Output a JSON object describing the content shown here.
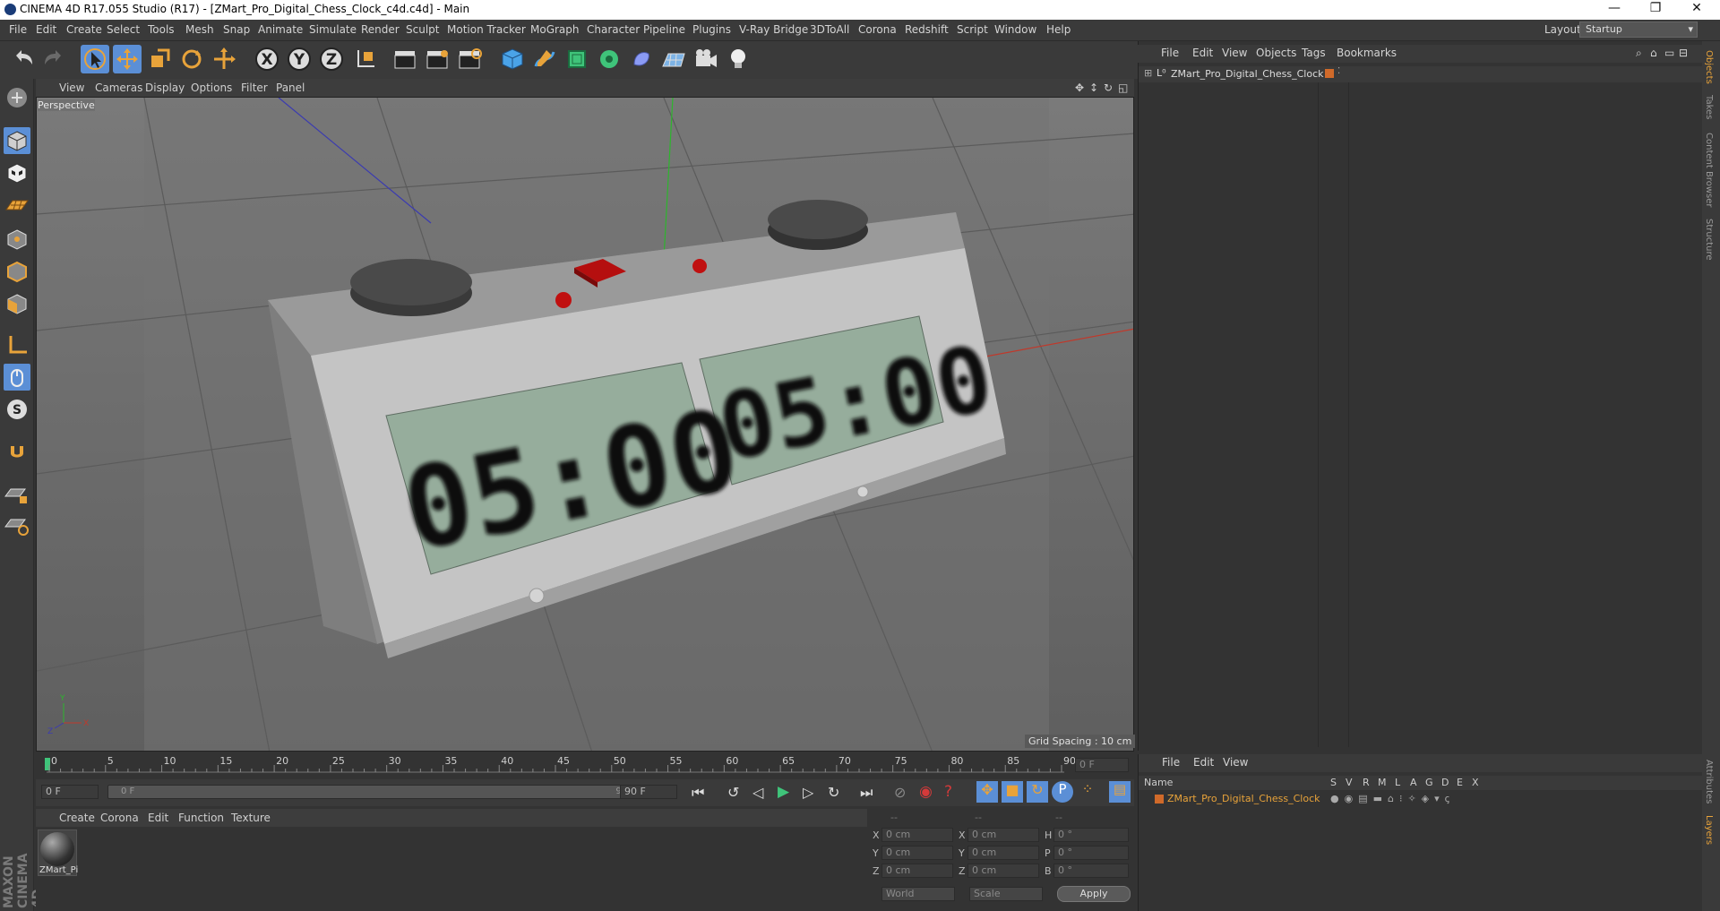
{
  "window": {
    "title": "CINEMA 4D R17.055 Studio (R17) - [ZMart_Pro_Digital_Chess_Clock_c4d.c4d] - Main",
    "min": "—",
    "max": "❐",
    "close": "✕"
  },
  "menubar": {
    "items": [
      "File",
      "Edit",
      "Create",
      "Select",
      "Tools",
      "Mesh",
      "Snap",
      "Animate",
      "Simulate",
      "Render",
      "Sculpt",
      "Motion Tracker",
      "MoGraph",
      "Character",
      "Pipeline",
      "Plugins",
      "V-Ray Bridge",
      "3DToAll",
      "Corona",
      "Redshift",
      "Script",
      "Window",
      "Help"
    ],
    "layout_label": "Layout:",
    "layout_value": "Startup"
  },
  "viewport": {
    "menu": [
      "View",
      "Cameras",
      "Display",
      "Options",
      "Filter",
      "Panel"
    ],
    "camera_label": "Perspective",
    "grid_spacing": "Grid Spacing : 10 cm",
    "clock_left": "05:00",
    "clock_right": "05:00",
    "axis_y": "Y",
    "axis_x": "X",
    "axis_z": "Z"
  },
  "timeline": {
    "ticks": [
      "0",
      "5",
      "10",
      "15",
      "20",
      "25",
      "30",
      "35",
      "40",
      "45",
      "50",
      "55",
      "60",
      "65",
      "70",
      "75",
      "80",
      "85",
      "90"
    ],
    "current_frame_field": "0 F",
    "start_field": "0 F",
    "range_start": "0 F",
    "range_end": "90 F",
    "end_field": "90 F"
  },
  "material_manager": {
    "menu": [
      "Create",
      "Corona",
      "Edit",
      "Function",
      "Texture"
    ],
    "material_name": "ZMart_Pi"
  },
  "coordinates": {
    "headers": [
      "--",
      "--",
      "--"
    ],
    "rows": [
      {
        "a": "X",
        "av": "0 cm",
        "b": "X",
        "bv": "0 cm",
        "c": "H",
        "cv": "0 °"
      },
      {
        "a": "Y",
        "av": "0 cm",
        "b": "Y",
        "bv": "0 cm",
        "c": "P",
        "cv": "0 °"
      },
      {
        "a": "Z",
        "av": "0 cm",
        "b": "Z",
        "bv": "0 cm",
        "c": "B",
        "cv": "0 °"
      }
    ],
    "space": "World",
    "mode": "Scale",
    "apply": "Apply"
  },
  "object_manager": {
    "menu": [
      "File",
      "Edit",
      "View",
      "Objects",
      "Tags",
      "Bookmarks"
    ],
    "object_name": "ZMart_Pro_Digital_Chess_Clock"
  },
  "layer_manager": {
    "menu": [
      "File",
      "Edit",
      "View"
    ],
    "col_name": "Name",
    "cols": [
      "S",
      "V",
      "R",
      "M",
      "L",
      "A",
      "G",
      "D",
      "E",
      "X"
    ],
    "layer_name": "ZMart_Pro_Digital_Chess_Clock"
  },
  "right_tabs": [
    "Objects",
    "Takes",
    "Content Browser",
    "Structure",
    "Attributes",
    "Layers"
  ],
  "brand": "MAXON CINEMA 4D",
  "colors": {
    "accent": "#e8a33a",
    "layer_orange": "#d06a2a",
    "selected_blue": "#5b8fd6"
  }
}
